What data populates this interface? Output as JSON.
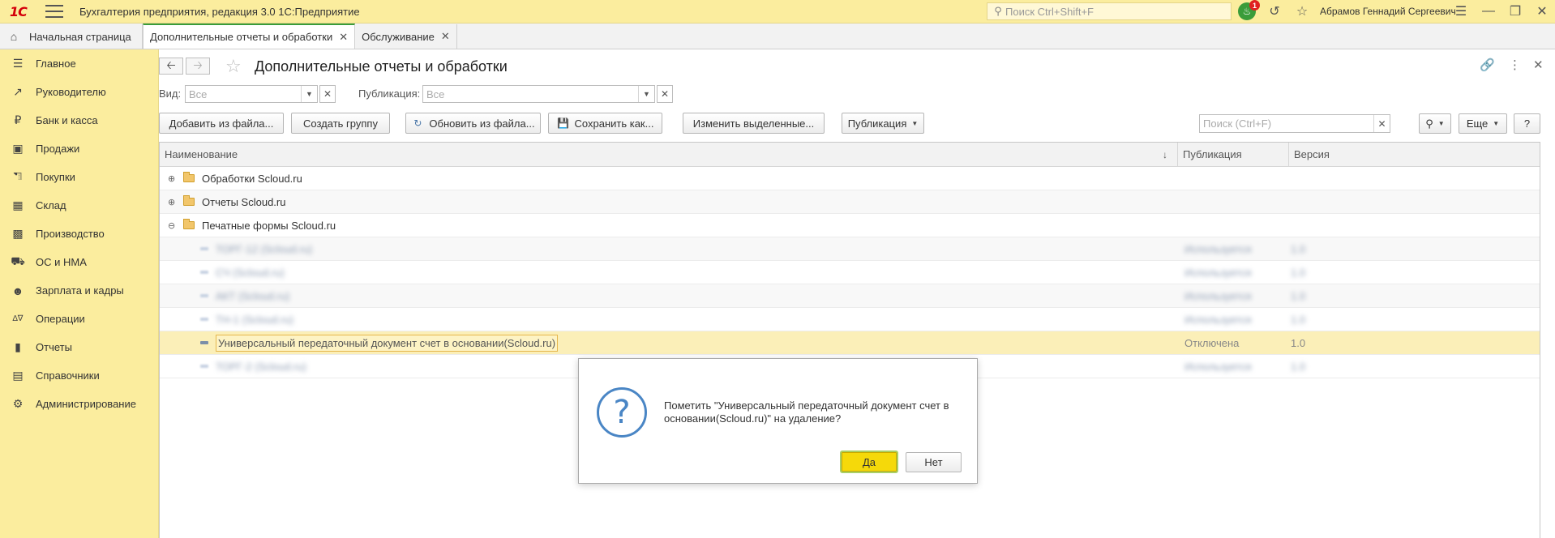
{
  "app": {
    "logo": "1С",
    "title": "Бухгалтерия предприятия, редакция 3.0 1С:Предприятие",
    "search_placeholder": "Поиск Ctrl+Shift+F",
    "notification_count": "1",
    "user": "Абрамов Геннадий Сергеевич"
  },
  "tabs": [
    {
      "label": "Начальная страница"
    },
    {
      "label": "Дополнительные отчеты и обработки",
      "active": true
    },
    {
      "label": "Обслуживание"
    }
  ],
  "sidebar": {
    "items": [
      {
        "label": "Главное",
        "icon": "menu-icon"
      },
      {
        "label": "Руководителю",
        "icon": "trend-icon"
      },
      {
        "label": "Банк и касса",
        "icon": "ruble-icon"
      },
      {
        "label": "Продажи",
        "icon": "bag-icon"
      },
      {
        "label": "Покупки",
        "icon": "cart-icon"
      },
      {
        "label": "Склад",
        "icon": "warehouse-icon"
      },
      {
        "label": "Производство",
        "icon": "factory-icon"
      },
      {
        "label": "ОС и НМА",
        "icon": "truck-icon"
      },
      {
        "label": "Зарплата и кадры",
        "icon": "person-icon"
      },
      {
        "label": "Операции",
        "icon": "debit-credit-icon"
      },
      {
        "label": "Отчеты",
        "icon": "chart-icon"
      },
      {
        "label": "Справочники",
        "icon": "book-icon"
      },
      {
        "label": "Администрирование",
        "icon": "gear-icon"
      }
    ]
  },
  "form": {
    "title": "Дополнительные отчеты и обработки",
    "filters": {
      "view_label": "Вид:",
      "view_placeholder": "Все",
      "publication_label": "Публикация:",
      "publication_placeholder": "Все"
    },
    "commands": {
      "add_from_file": "Добавить из файла...",
      "create_group": "Создать группу",
      "update_from_file": "Обновить из файла...",
      "save_as": "Сохранить как...",
      "change_selected": "Изменить выделенные...",
      "publication": "Публикация",
      "search_placeholder": "Поиск (Ctrl+F)",
      "more": "Еще",
      "help": "?"
    },
    "table": {
      "columns": [
        "Наименование",
        "Публикация",
        "Версия"
      ],
      "rows": [
        {
          "name": "Обработки Scloud.ru",
          "type": "group",
          "expanded": false
        },
        {
          "name": "Отчеты Scloud.ru",
          "type": "group",
          "expanded": false
        },
        {
          "name": "Печатные формы Scloud.ru",
          "type": "group",
          "expanded": true
        },
        {
          "name": "ТОРГ-12 (Scloud.ru)",
          "type": "item",
          "publication": "Используется",
          "version": "1.0",
          "blurred": true
        },
        {
          "name": "СЧ (Scloud.ru)",
          "type": "item",
          "publication": "Используется",
          "version": "1.0",
          "blurred": true
        },
        {
          "name": "АКТ (Scloud.ru)",
          "type": "item",
          "publication": "Используется",
          "version": "1.0",
          "blurred": true
        },
        {
          "name": "ТН-1 (Scloud.ru)",
          "type": "item",
          "publication": "Используется",
          "version": "1.0",
          "blurred": true
        },
        {
          "name": "Универсальный передаточный документ счет в основании(Scloud.ru)",
          "type": "item",
          "publication": "Отключена",
          "version": "1.0",
          "selected": true
        },
        {
          "name": "ТОРГ-2 (Scloud.ru)",
          "type": "item",
          "publication": "Используется",
          "version": "1.0",
          "blurred": true
        }
      ]
    }
  },
  "dialog": {
    "message": "Пометить \"Универсальный передаточный документ счет в основании(Scloud.ru)\" на удаление?",
    "yes": "Да",
    "no": "Нет"
  }
}
